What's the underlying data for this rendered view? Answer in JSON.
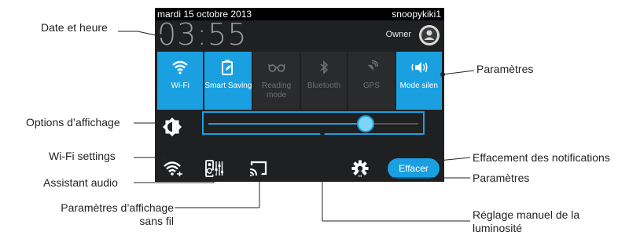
{
  "status_bar": {
    "date": "mardi 15 octobre 2013",
    "user": "snoopykiki1"
  },
  "clock": {
    "time": "03:55",
    "owner": "Owner"
  },
  "toggles": [
    {
      "label": "Wi-Fi",
      "icon": "wifi-icon",
      "state": "on"
    },
    {
      "label": "Smart Saving",
      "icon": "smart-saving-icon",
      "state": "on"
    },
    {
      "label": "Reading mode",
      "icon": "reading-glasses-icon",
      "state": "off"
    },
    {
      "label": "Bluetooth",
      "icon": "bluetooth-icon",
      "state": "off"
    },
    {
      "label": "GPS",
      "icon": "gps-icon",
      "state": "off"
    },
    {
      "label": "Mode silen",
      "icon": "speaker-vibrate-icon",
      "state": "on"
    }
  ],
  "brightness": {
    "level_percent": 75,
    "icon": "brightness-icon"
  },
  "bottom_bar": {
    "icons": [
      "wifi-settings-icon",
      "audio-wizard-icon",
      "wireless-display-icon",
      "gear-icon"
    ],
    "clear_label": "Effacer"
  },
  "callouts": {
    "date_time": "Date et heure",
    "display_options": "Options d’affichage",
    "wifi_settings": "Wi-Fi settings",
    "audio_wizard": "Assistant audio",
    "wireless_display_1": "Paramètres d’affichage",
    "wireless_display_2": "sans fil",
    "settings_top": "Paramètres",
    "clear_notifications": "Effacement des notifications",
    "settings_bottom": "Paramètres",
    "manual_brightness_1": "Réglage manuel de la",
    "manual_brightness_2": "luminosité"
  },
  "colors": {
    "accent": "#1aa0e0",
    "panel": "#1f2022",
    "statusbar": "#000000"
  }
}
